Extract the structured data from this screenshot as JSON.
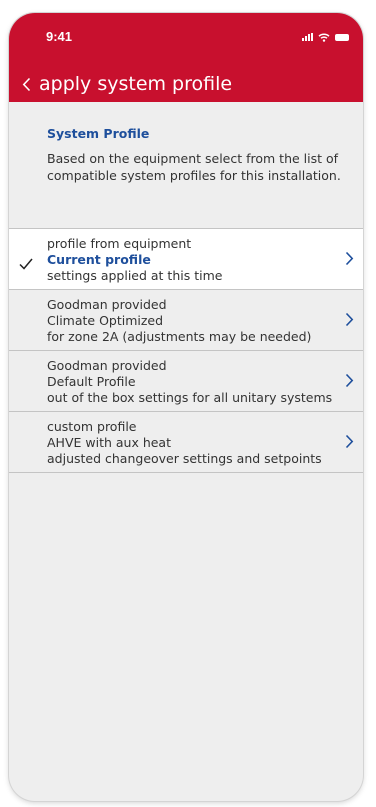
{
  "status_bar": {
    "time": "9:41"
  },
  "header": {
    "title": "apply system profile",
    "back_icon": "chevron-left-icon"
  },
  "intro": {
    "title": "System  Profile",
    "description": "Based on the equipment select from the list of compatible system profiles for this installation."
  },
  "profiles": [
    {
      "line1": "profile from equipment",
      "line2": "Current profile",
      "line3": "settings applied at this time",
      "selected": true
    },
    {
      "line1": "Goodman provided",
      "line2": "Climate Optimized",
      "line3": "for zone 2A (adjustments may be needed)",
      "selected": false
    },
    {
      "line1": "Goodman provided",
      "line2": "Default Profile",
      "line3": "out of the box settings for all unitary systems",
      "selected": false
    },
    {
      "line1": "custom profile",
      "line2": "AHVE with aux heat",
      "line3": "adjusted changeover settings and setpoints",
      "selected": false
    }
  ],
  "colors": {
    "header_red": "#c8102e",
    "accent_blue": "#1e4f9c",
    "background": "#eeeeee"
  }
}
